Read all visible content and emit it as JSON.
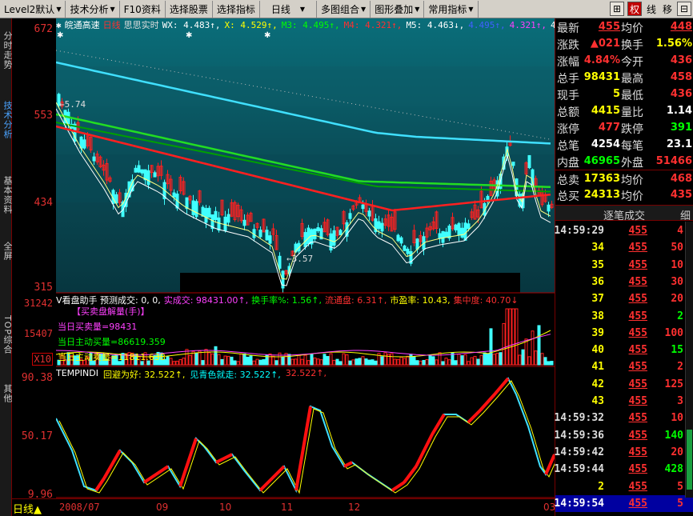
{
  "toolbar": {
    "items": [
      "Level2默认",
      "技术分析",
      "F10资料",
      "选择股票",
      "选择指标",
      "日线",
      "多图组合",
      "图形叠加",
      "常用指标"
    ],
    "right_buttons": [
      "⊞",
      "权",
      "线",
      "移",
      "⊟"
    ]
  },
  "left_tabs": [
    "分时走势",
    "技术分析",
    "基本资料",
    "全屏",
    "TOP综合",
    "其他"
  ],
  "price_axis": [
    "672",
    "553",
    "434",
    "315"
  ],
  "chart_header": {
    "stock": "皖通高速",
    "period": "日线",
    "indicator": "思思实时",
    "items": [
      {
        "label": "WX: 4.483↑,",
        "color": "#ffffff"
      },
      {
        "label": "X: 4.529↑,",
        "color": "#ffff00"
      },
      {
        "label": "M3: 4.495↑,",
        "color": "#00ff00"
      },
      {
        "label": "M4: 4.321↑,",
        "color": "#ff3030"
      },
      {
        "label": "M5: 4.463↓,",
        "color": "#ffffff"
      },
      {
        "label": "4.495↑,",
        "color": "#4060ff"
      },
      {
        "label": "4.321↑,",
        "color": "#ff40ff"
      },
      {
        "label": "4.463↑",
        "color": "#ffffff"
      }
    ]
  },
  "annotations": {
    "high": "5.74",
    "low": "3.57"
  },
  "vol_header": {
    "title": "V看盘助手 预测成交: 0, 0,",
    "items": [
      {
        "label": "实成交: 98431.00↑,",
        "color": "#ff40ff"
      },
      {
        "label": "换手率%: 1.56↑,",
        "color": "#00ff00"
      },
      {
        "label": "流通盘: 6.31↑,",
        "color": "#ff3030"
      },
      {
        "label": "市盈率: 10.43,",
        "color": "#ffff00"
      },
      {
        "label": "集中度: 40.70↓",
        "color": "#ff3030"
      }
    ],
    "lines": [
      {
        "label": "【买卖盘解量(手)】",
        "color": "#ff40ff"
      },
      {
        "label": "当日买卖量=98431",
        "color": "#ff40ff"
      },
      {
        "label": "当日主动买量=86619.359",
        "color": "#00ff00"
      },
      {
        "label": "当日主动卖量=11811.638",
        "color": "#ffff00"
      }
    ]
  },
  "vol_axis": [
    "31242",
    "15407",
    "X10"
  ],
  "osc_header": {
    "items": [
      {
        "label": "TEMPINDI",
        "color": "#ffffff"
      },
      {
        "label": "回避为好: 32.522↑,",
        "color": "#ffff00"
      },
      {
        "label": "见青色就走: 32.522↑,",
        "color": "#00ffff"
      },
      {
        "label": "32.522↑,",
        "color": "#ff3030"
      }
    ]
  },
  "osc_axis": [
    "90.38",
    "50.17",
    "9.96"
  ],
  "bottom_bar": {
    "period": "日线",
    "dates": [
      "2008/07",
      "09",
      "10",
      "11",
      "12",
      "03"
    ]
  },
  "quote": [
    {
      "l1": "最新",
      "v1": "455",
      "l2": "均价",
      "v2": "448"
    },
    {
      "l1": "涨跌",
      "v1": "▲021",
      "l2": "换手",
      "v2": "1.56%"
    },
    {
      "l1": "涨幅",
      "v1": "4.84%",
      "l2": "今开",
      "v2": "436"
    },
    {
      "l1": "总手",
      "v1": "98431",
      "l2": "最高",
      "v2": "458"
    },
    {
      "l1": "现手",
      "v1": "5",
      "l2": "最低",
      "v2": "436"
    },
    {
      "l1": "总额",
      "v1": "4415",
      "l2": "量比",
      "v2": "1.14"
    },
    {
      "l1": "涨停",
      "v1": "477",
      "l2": "跌停",
      "v2": "391"
    },
    {
      "l1": "总笔",
      "v1": "4254",
      "l2": "每笔",
      "v2": "23.1"
    },
    {
      "l1": "内盘",
      "v1": "46965",
      "l2": "外盘",
      "v2": "51466"
    },
    {
      "l1": "总卖",
      "v1": "17363",
      "l2": "均价",
      "v2": "468"
    },
    {
      "l1": "总买",
      "v1": "24313",
      "l2": "均价",
      "v2": "435"
    }
  ],
  "ticks_header": {
    "title": "逐笔成交",
    "btn": "细"
  },
  "ticks": [
    {
      "t": "14:59:29",
      "p": "455",
      "v": "4"
    },
    {
      "t": "34",
      "p": "455",
      "v": "50"
    },
    {
      "t": "35",
      "p": "455",
      "v": "10"
    },
    {
      "t": "36",
      "p": "455",
      "v": "30"
    },
    {
      "t": "37",
      "p": "455",
      "v": "20"
    },
    {
      "t": "38",
      "p": "455",
      "v": "2"
    },
    {
      "t": "39",
      "p": "455",
      "v": "100"
    },
    {
      "t": "40",
      "p": "455",
      "v": "15"
    },
    {
      "t": "41",
      "p": "455",
      "v": "2"
    },
    {
      "t": "42",
      "p": "455",
      "v": "125"
    },
    {
      "t": "43",
      "p": "455",
      "v": "3"
    },
    {
      "t": "14:59:32",
      "p": "455",
      "v": "10"
    },
    {
      "t": "14:59:36",
      "p": "455",
      "v": "140"
    },
    {
      "t": "14:59:42",
      "p": "455",
      "v": "20"
    },
    {
      "t": "14:59:44",
      "p": "455",
      "v": "428"
    },
    {
      "t": "2",
      "p": "455",
      "v": "5"
    },
    {
      "t": "14:59:54",
      "p": "455",
      "v": "5"
    }
  ]
}
